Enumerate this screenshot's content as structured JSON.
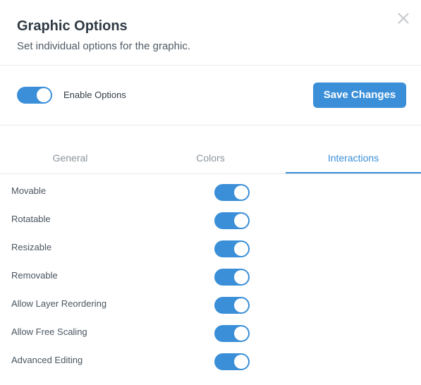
{
  "dialog": {
    "title": "Graphic Options",
    "subtitle": "Set individual options for the graphic."
  },
  "options_bar": {
    "enable_label": "Enable Options",
    "enable_on": true,
    "save_label": "Save Changes"
  },
  "tabs": [
    {
      "label": "General",
      "active": false
    },
    {
      "label": "Colors",
      "active": false
    },
    {
      "label": "Interactions",
      "active": true
    }
  ],
  "interactions": [
    {
      "label": "Movable",
      "on": true
    },
    {
      "label": "Rotatable",
      "on": true
    },
    {
      "label": "Resizable",
      "on": true
    },
    {
      "label": "Removable",
      "on": true
    },
    {
      "label": "Allow Layer Reordering",
      "on": true
    },
    {
      "label": "Allow Free Scaling",
      "on": true
    },
    {
      "label": "Advanced Editing",
      "on": true
    }
  ],
  "colors": {
    "accent": "#3a8fd8",
    "divider": "#ececec"
  }
}
